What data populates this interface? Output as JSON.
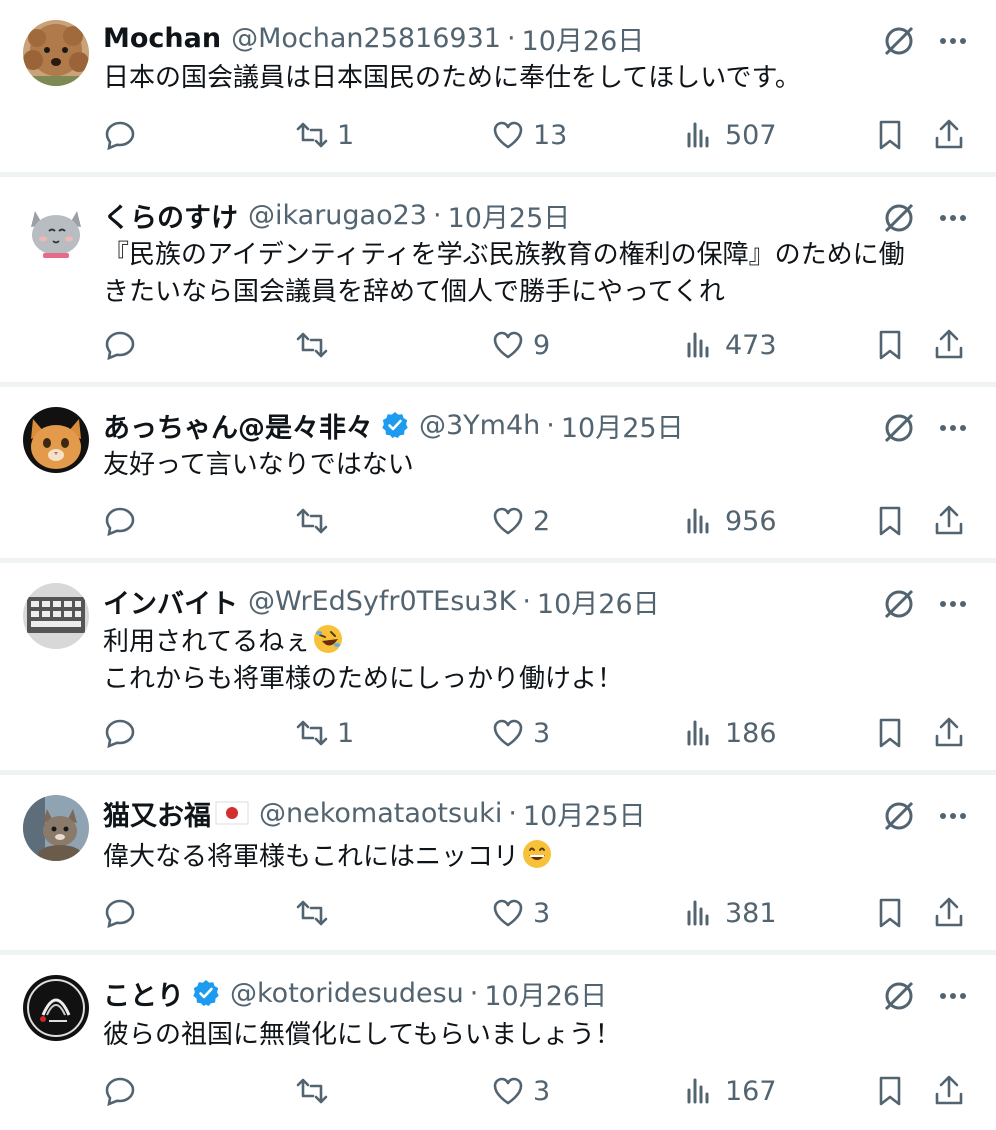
{
  "posts": [
    {
      "name": "Mochan",
      "handle": "@Mochan25816931",
      "separator": "·",
      "date": "10月26日",
      "verified": false,
      "lines": [
        "日本の国会議員は日本国民のために奉仕をしてほしいです。"
      ],
      "replies": "",
      "reposts": "1",
      "likes": "13",
      "views": "507",
      "avatar": "dog-avatar"
    },
    {
      "name": "くらのすけ",
      "handle": "@ikarugao23",
      "separator": "·",
      "date": "10月25日",
      "verified": false,
      "lines": [
        "『民族のアイデンティティを学ぶ民族教育の権利の保障』のために働",
        "きたいなら国会議員を辞めて個人で勝手にやってくれ"
      ],
      "replies": "",
      "reposts": "",
      "likes": "9",
      "views": "473",
      "avatar": "cat-illustration-avatar"
    },
    {
      "name": "あっちゃん@是々非々",
      "handle": "@3Ym4h",
      "separator": "·",
      "date": "10月25日",
      "verified": true,
      "lines": [
        "友好って言いなりではない"
      ],
      "replies": "",
      "reposts": "",
      "likes": "2",
      "views": "956",
      "avatar": "kitten-avatar"
    },
    {
      "name": "インバイト",
      "handle": "@WrEdSyfr0TEsu3K",
      "separator": "·",
      "date": "10月26日",
      "verified": false,
      "lines": [
        "利用されてるねぇ",
        "これからも将軍様のためにしっかり働けよ！"
      ],
      "emoji": "rolling-on-floor-laughing-emoji",
      "replies": "",
      "reposts": "1",
      "likes": "3",
      "views": "186",
      "avatar": "keyboard-avatar"
    },
    {
      "name": "猫又お福",
      "handle": "@nekomataotsuki",
      "separator": "·",
      "date": "10月25日",
      "verified": false,
      "flag": "japan-flag-emoji",
      "lines": [
        "偉大なる将軍様もこれにはニッコリ"
      ],
      "emoji": "grinning-face-emoji",
      "replies": "",
      "reposts": "",
      "likes": "3",
      "views": "381",
      "avatar": "cat-photo-avatar"
    },
    {
      "name": "ことり",
      "handle": "@kotoridesudesu",
      "separator": "·",
      "date": "10月26日",
      "verified": true,
      "lines": [
        "彼らの祖国に無償化にしてもらいましょう！"
      ],
      "replies": "",
      "reposts": "",
      "likes": "3",
      "views": "167",
      "avatar": "crest-avatar"
    }
  ],
  "icons": {
    "reply": "reply-icon",
    "repost": "repost-icon",
    "like": "like-icon",
    "views": "views-icon",
    "bookmark": "bookmark-icon",
    "share": "share-icon",
    "grok": "grok-icon",
    "more": "more-icon",
    "verified": "verified-badge-icon"
  },
  "colors": {
    "text": "#0f1419",
    "secondary": "#536471",
    "verified": "#1d9bf0",
    "separator": "#eff3f4"
  }
}
